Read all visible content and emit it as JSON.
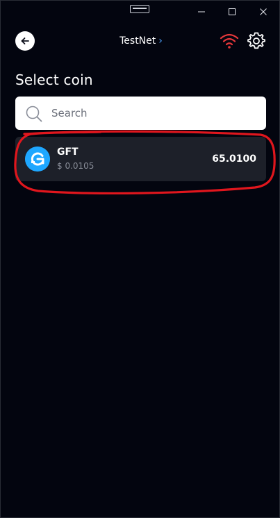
{
  "window": {
    "controls": {
      "minimize_icon": "minimize-icon",
      "maximize_icon": "maximize-icon",
      "close_icon": "close-icon"
    }
  },
  "header": {
    "back_icon": "arrow-left-icon",
    "network": "TestNet",
    "network_chevron": "›",
    "status_icon": "wifi-icon",
    "status_color": "#e5373a",
    "settings_icon": "gear-icon"
  },
  "page": {
    "title": "Select coin"
  },
  "search": {
    "placeholder": "Search",
    "value": ""
  },
  "coins": [
    {
      "symbol": "GFT",
      "price": "$ 0.0105",
      "balance": "65.0100",
      "logo_color": "#1ea7ff"
    }
  ],
  "colors": {
    "background": "#03050f",
    "row_background": "#1d2029",
    "accent": "#4da3ff",
    "annotation": "#e0161d"
  }
}
